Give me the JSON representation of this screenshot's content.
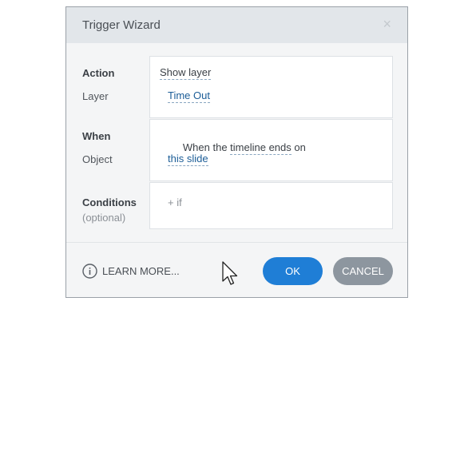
{
  "dialog": {
    "title": "Trigger Wizard",
    "close_glyph": "×"
  },
  "action": {
    "label": "Action",
    "value": "Show layer",
    "sub_label": "Layer",
    "sub_value": "Time Out"
  },
  "when": {
    "label": "When",
    "prefix": "When the ",
    "event": "timeline ends",
    "suffix": " on",
    "sub_label": "Object",
    "sub_value": "this slide"
  },
  "conditions": {
    "label": "Conditions",
    "optional": "(optional)",
    "add": "+ if"
  },
  "footer": {
    "learn_more": "LEARN MORE...",
    "ok": "OK",
    "cancel": "CANCEL"
  },
  "icons": {
    "info": "info-icon",
    "close": "close-icon",
    "cursor": "mouse-cursor-icon"
  },
  "colors": {
    "ok_button": "#1f7ed6",
    "cancel_button": "#8d969f",
    "link_blue": "#1c5d97"
  }
}
